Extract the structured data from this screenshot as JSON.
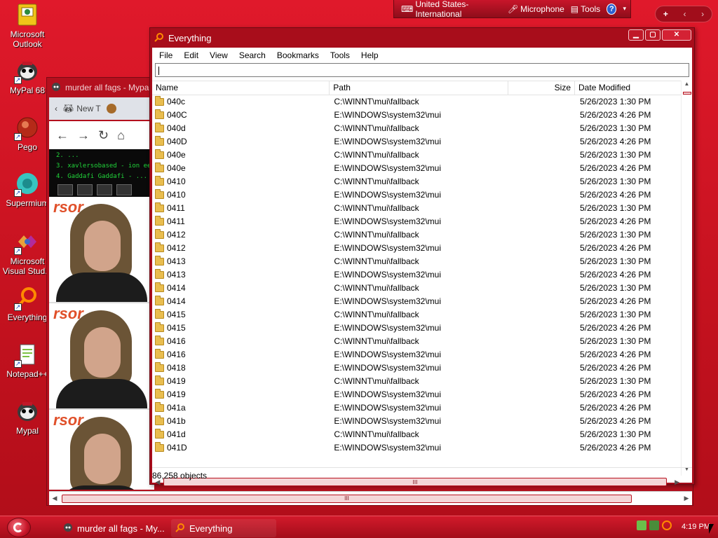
{
  "desktop": {
    "icons": [
      {
        "label": "Microsoft Outlook",
        "icon": "outlook-icon"
      },
      {
        "label": "MyPal 68",
        "icon": "mypal-icon"
      },
      {
        "label": "Pego",
        "icon": "pego-icon"
      },
      {
        "label": "Supermium",
        "icon": "supermium-icon"
      },
      {
        "label": "Microsoft Visual Stud...",
        "icon": "visual-studio-icon"
      },
      {
        "label": "Everything",
        "icon": "everything-icon"
      },
      {
        "label": "Notepad++",
        "icon": "notepadpp-icon"
      },
      {
        "label": "Mypal",
        "icon": "mypal-icon"
      }
    ]
  },
  "language_bar": {
    "language": "United States-International",
    "microphone": "Microphone",
    "tools": "Tools",
    "help": "?"
  },
  "top_widget": {
    "plus": "+",
    "prev": "‹",
    "next": "›"
  },
  "background_window": {
    "title": "murder all fags - Mypal",
    "tab_label": "New T",
    "green_list": [
      "2. ...",
      "3. xavlersobased - ion een k",
      "4. Gaddafi Gaddafi - ..."
    ],
    "photo_caption": "rsor"
  },
  "everything_window": {
    "title": "Everything",
    "menu": [
      "File",
      "Edit",
      "View",
      "Search",
      "Bookmarks",
      "Tools",
      "Help"
    ],
    "search_value": "",
    "columns": {
      "name": "Name",
      "path": "Path",
      "size": "Size",
      "date": "Date Modified"
    },
    "rows": [
      {
        "name": "040c",
        "path": "C:\\WINNT\\mui\\fallback",
        "date": "5/26/2023 1:30 PM"
      },
      {
        "name": "040C",
        "path": "E:\\WINDOWS\\system32\\mui",
        "date": "5/26/2023 4:26 PM"
      },
      {
        "name": "040d",
        "path": "C:\\WINNT\\mui\\fallback",
        "date": "5/26/2023 1:30 PM"
      },
      {
        "name": "040D",
        "path": "E:\\WINDOWS\\system32\\mui",
        "date": "5/26/2023 4:26 PM"
      },
      {
        "name": "040e",
        "path": "C:\\WINNT\\mui\\fallback",
        "date": "5/26/2023 1:30 PM"
      },
      {
        "name": "040e",
        "path": "E:\\WINDOWS\\system32\\mui",
        "date": "5/26/2023 4:26 PM"
      },
      {
        "name": "0410",
        "path": "C:\\WINNT\\mui\\fallback",
        "date": "5/26/2023 1:30 PM"
      },
      {
        "name": "0410",
        "path": "E:\\WINDOWS\\system32\\mui",
        "date": "5/26/2023 4:26 PM"
      },
      {
        "name": "0411",
        "path": "C:\\WINNT\\mui\\fallback",
        "date": "5/26/2023 1:30 PM"
      },
      {
        "name": "0411",
        "path": "E:\\WINDOWS\\system32\\mui",
        "date": "5/26/2023 4:26 PM"
      },
      {
        "name": "0412",
        "path": "C:\\WINNT\\mui\\fallback",
        "date": "5/26/2023 1:30 PM"
      },
      {
        "name": "0412",
        "path": "E:\\WINDOWS\\system32\\mui",
        "date": "5/26/2023 4:26 PM"
      },
      {
        "name": "0413",
        "path": "C:\\WINNT\\mui\\fallback",
        "date": "5/26/2023 1:30 PM"
      },
      {
        "name": "0413",
        "path": "E:\\WINDOWS\\system32\\mui",
        "date": "5/26/2023 4:26 PM"
      },
      {
        "name": "0414",
        "path": "C:\\WINNT\\mui\\fallback",
        "date": "5/26/2023 1:30 PM"
      },
      {
        "name": "0414",
        "path": "E:\\WINDOWS\\system32\\mui",
        "date": "5/26/2023 4:26 PM"
      },
      {
        "name": "0415",
        "path": "C:\\WINNT\\mui\\fallback",
        "date": "5/26/2023 1:30 PM"
      },
      {
        "name": "0415",
        "path": "E:\\WINDOWS\\system32\\mui",
        "date": "5/26/2023 4:26 PM"
      },
      {
        "name": "0416",
        "path": "C:\\WINNT\\mui\\fallback",
        "date": "5/26/2023 1:30 PM"
      },
      {
        "name": "0416",
        "path": "E:\\WINDOWS\\system32\\mui",
        "date": "5/26/2023 4:26 PM"
      },
      {
        "name": "0418",
        "path": "E:\\WINDOWS\\system32\\mui",
        "date": "5/26/2023 4:26 PM"
      },
      {
        "name": "0419",
        "path": "C:\\WINNT\\mui\\fallback",
        "date": "5/26/2023 1:30 PM"
      },
      {
        "name": "0419",
        "path": "E:\\WINDOWS\\system32\\mui",
        "date": "5/26/2023 4:26 PM"
      },
      {
        "name": "041a",
        "path": "E:\\WINDOWS\\system32\\mui",
        "date": "5/26/2023 4:26 PM"
      },
      {
        "name": "041b",
        "path": "E:\\WINDOWS\\system32\\mui",
        "date": "5/26/2023 4:26 PM"
      },
      {
        "name": "041d",
        "path": "C:\\WINNT\\mui\\fallback",
        "date": "5/26/2023 1:30 PM"
      },
      {
        "name": "041D",
        "path": "E:\\WINDOWS\\system32\\mui",
        "date": "5/26/2023 4:26 PM"
      }
    ],
    "status": "86,258 objects",
    "scroll_grip": "III"
  },
  "taskbar": {
    "buttons": [
      {
        "label": "murder all fags - My...",
        "icon": "mypal-icon"
      },
      {
        "label": "Everything",
        "icon": "everything-icon"
      }
    ],
    "clock": "4:19 PM"
  },
  "colors": {
    "accent": "#c8152a",
    "folder": "#e9bd4f",
    "terminal_green": "#21d43a"
  }
}
